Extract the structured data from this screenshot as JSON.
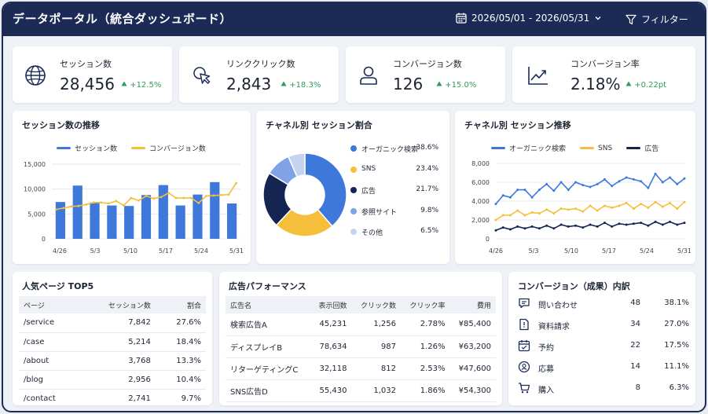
{
  "header": {
    "title": "データポータル（統合ダッシュボード）",
    "date_range": "2026/05/01 - 2026/05/31",
    "filter_label": "フィルター"
  },
  "kpis": [
    {
      "label": "セッション数",
      "value": "28,456",
      "delta": "+12.5%",
      "icon": "globe-icon"
    },
    {
      "label": "リンククリック数",
      "value": "2,843",
      "delta": "+18.3%",
      "icon": "cursor-click-icon"
    },
    {
      "label": "コンバージョン数",
      "value": "126",
      "delta": "+15.0%",
      "icon": "user-icon"
    },
    {
      "label": "コンバージョン率",
      "value": "2.18%",
      "delta": "+0.22pt",
      "icon": "trend-chart-icon"
    }
  ],
  "colors": {
    "primary": "#3f78db",
    "accent": "#f5be3b",
    "navy": "#142552",
    "light": "#9bb8ea",
    "lighter": "#c4d4f0",
    "up": "#2e9b5d"
  },
  "sessions_chart": {
    "title": "セッション数の推移",
    "legend": [
      "セッション数",
      "コンバージョン数"
    ]
  },
  "channel_pie": {
    "title": "チャネル別 セッション割合",
    "items": [
      {
        "name": "オーガニック検索",
        "pct": "38.6%"
      },
      {
        "name": "SNS",
        "pct": "23.4%"
      },
      {
        "name": "広告",
        "pct": "21.7%"
      },
      {
        "name": "参照サイト",
        "pct": "9.8%"
      },
      {
        "name": "その他",
        "pct": "6.5%"
      }
    ]
  },
  "channel_trend": {
    "title": "チャネル別 セッション推移",
    "legend": [
      "オーガニック検索",
      "SNS",
      "広告"
    ]
  },
  "top_pages": {
    "title": "人気ページ TOP5",
    "headers": [
      "ページ",
      "セッション数",
      "割合"
    ],
    "rows": [
      [
        "/service",
        "7,842",
        "27.6%"
      ],
      [
        "/case",
        "5,214",
        "18.4%"
      ],
      [
        "/about",
        "3,768",
        "13.3%"
      ],
      [
        "/blog",
        "2,956",
        "10.4%"
      ],
      [
        "/contact",
        "2,741",
        "9.7%"
      ]
    ]
  },
  "ad_performance": {
    "title": "広告パフォーマンス",
    "headers": [
      "広告名",
      "表示回数",
      "クリック数",
      "クリック率",
      "費用"
    ],
    "rows": [
      [
        "検索広告A",
        "45,231",
        "1,256",
        "2.78%",
        "¥85,400"
      ],
      [
        "ディスプレイB",
        "78,634",
        "987",
        "1.26%",
        "¥63,200"
      ],
      [
        "リターゲティングC",
        "32,118",
        "812",
        "2.53%",
        "¥47,600"
      ],
      [
        "SNS広告D",
        "55,430",
        "1,032",
        "1.86%",
        "¥54,300"
      ]
    ]
  },
  "conversions": {
    "title": "コンバージョン（成果）内訳",
    "rows": [
      {
        "name": "問い合わせ",
        "count": "48",
        "pct": "38.1%",
        "icon": "chat-bubble-icon"
      },
      {
        "name": "資料請求",
        "count": "34",
        "pct": "27.0%",
        "icon": "document-icon"
      },
      {
        "name": "予約",
        "count": "22",
        "pct": "17.5%",
        "icon": "calendar-check-icon"
      },
      {
        "name": "応募",
        "count": "14",
        "pct": "11.1%",
        "icon": "badge-icon"
      },
      {
        "name": "購入",
        "count": "8",
        "pct": "6.3%",
        "icon": "cart-icon"
      }
    ]
  },
  "chart_data": [
    {
      "type": "bar",
      "title": "セッション数の推移",
      "x_ticks": [
        "4/26",
        "5/3",
        "5/10",
        "5/17",
        "5/24",
        "5/31"
      ],
      "ylim": [
        0,
        15000
      ],
      "y_ticks": [
        "0",
        "5,000",
        "10,000",
        "15,000"
      ],
      "grid": true,
      "legend": "top-center",
      "series": [
        {
          "name": "セッション数",
          "chart": "bar",
          "values": [
            7400,
            10700,
            7300,
            6700,
            6600,
            8800,
            10800,
            6700,
            8900,
            11400,
            7100
          ]
        },
        {
          "name": "コンバージョン数",
          "chart": "line",
          "values": [
            5900,
            6200,
            6500,
            6600,
            6900,
            7300,
            7300,
            7100,
            7600,
            6700,
            8200,
            7700,
            8600,
            8100,
            8400,
            9200,
            8200,
            8200,
            8200,
            7200,
            8600,
            8700,
            8800,
            8900,
            11200
          ]
        }
      ]
    },
    {
      "type": "pie",
      "title": "チャネル別 セッション割合",
      "labels": [
        "オーガニック検索",
        "SNS",
        "広告",
        "参照サイト",
        "その他"
      ],
      "values": [
        38.6,
        23.4,
        21.7,
        9.8,
        6.5
      ]
    },
    {
      "type": "line",
      "title": "チャネル別 セッション推移",
      "x_ticks": [
        "4/26",
        "5/3",
        "5/10",
        "5/17",
        "5/24",
        "5/31"
      ],
      "ylim": [
        0,
        8000
      ],
      "y_ticks": [
        "0",
        "2,000",
        "4,000",
        "6,000",
        "8,000"
      ],
      "grid": true,
      "legend": "top-center",
      "series": [
        {
          "name": "オーガニック検索",
          "values": [
            3700,
            4600,
            4400,
            5200,
            5200,
            4400,
            5200,
            5800,
            5100,
            6000,
            5200,
            6000,
            5700,
            5500,
            5800,
            6300,
            5600,
            6100,
            6500,
            6300,
            6100,
            5400,
            6900,
            6000,
            6500,
            5800,
            6400
          ]
        },
        {
          "name": "SNS",
          "values": [
            2000,
            2500,
            2500,
            3000,
            2500,
            2800,
            2700,
            3100,
            2700,
            3200,
            3100,
            3200,
            2900,
            3500,
            3000,
            3500,
            3300,
            3500,
            3800,
            3200,
            3700,
            3300,
            3900,
            3400,
            3800,
            3200,
            3900
          ]
        },
        {
          "name": "広告",
          "values": [
            900,
            1200,
            1000,
            1300,
            1100,
            1300,
            1100,
            1400,
            1100,
            1500,
            1300,
            1400,
            1200,
            1500,
            1300,
            1700,
            1300,
            1600,
            1500,
            1600,
            1700,
            1400,
            1800,
            1500,
            1800,
            1500,
            1700
          ]
        }
      ]
    }
  ]
}
